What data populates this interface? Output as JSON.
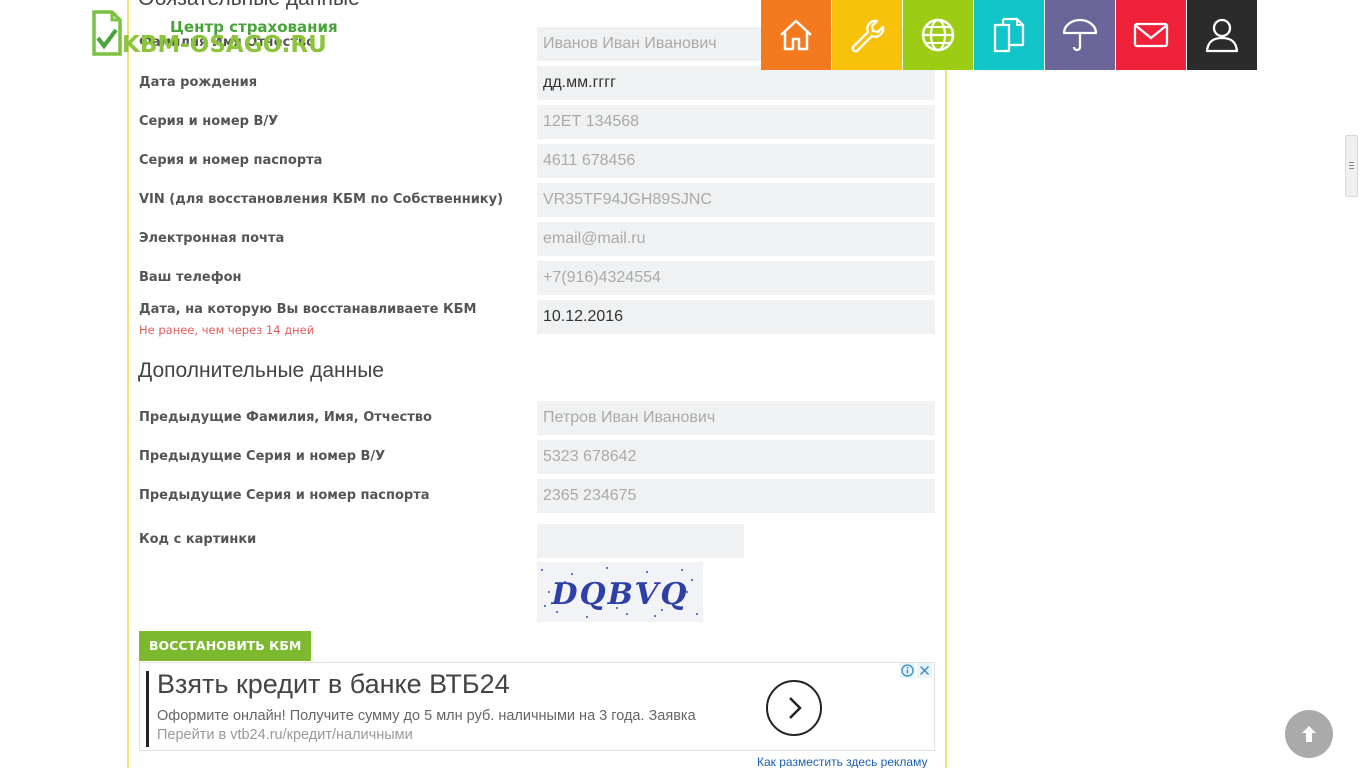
{
  "header": {
    "logo_top": "Центр страхования",
    "logo_bottom": "KBM-OSAGO.RU",
    "nav": [
      {
        "name": "home",
        "color": "#f47a20",
        "icon": "home-icon"
      },
      {
        "name": "tools",
        "color": "#f9c20a",
        "icon": "wrench-icon"
      },
      {
        "name": "web",
        "color": "#9dcc15",
        "icon": "globe-icon"
      },
      {
        "name": "documents",
        "color": "#11c4c8",
        "icon": "documents-icon"
      },
      {
        "name": "insurance",
        "color": "#6a6699",
        "icon": "umbrella-icon"
      },
      {
        "name": "mail",
        "color": "#f0223a",
        "icon": "mail-icon"
      },
      {
        "name": "account",
        "color": "#2b2b2b",
        "icon": "user-icon"
      }
    ]
  },
  "form": {
    "required_title": "Обязательные данные",
    "fields": [
      {
        "label": "Фамилия Имя Отчество",
        "placeholder": "Иванов Иван Иванович",
        "value": ""
      },
      {
        "label": "Дата рождения",
        "placeholder": "дд.мм.гггг",
        "value": "дд.мм.гггг"
      },
      {
        "label": "Серия и номер В/У",
        "placeholder": "12ЕТ 134568",
        "value": ""
      },
      {
        "label": "Серия и номер паспорта",
        "placeholder": "4611 678456",
        "value": ""
      },
      {
        "label": "VIN (для восстановления КБМ по Собственнику)",
        "placeholder": "VR35TF94JGH89SJNC",
        "value": ""
      },
      {
        "label": "Электронная почта",
        "placeholder": "email@mail.ru",
        "value": ""
      },
      {
        "label": "Ваш телефон",
        "placeholder": "+7(916)4324554",
        "value": ""
      },
      {
        "label": "Дата, на которую Вы восстанавливаете КБМ",
        "note": "Не ранее, чем через 14 дней",
        "placeholder": "",
        "value": "10.12.2016"
      }
    ],
    "additional_title": "Дополнительные данные",
    "additional_fields": [
      {
        "label": "Предыдущие Фамилия, Имя, Отчество",
        "placeholder": "Петров Иван Иванович",
        "value": ""
      },
      {
        "label": "Предыдущие Серия и номер В/У",
        "placeholder": "5323 678642",
        "value": ""
      },
      {
        "label": "Предыдущие Серия и номер паспорта",
        "placeholder": "2365 234675",
        "value": ""
      }
    ],
    "captcha_label": "Код с картинки",
    "captcha_text": "DQBVQ",
    "submit_label": "ВОССТАНОВИТЬ КБМ"
  },
  "ad": {
    "title": "Взять кредит в банке ВТБ24",
    "text": "Оформите онлайн! Получите сумму до 5 млн руб. наличными на 3 года. Заявка",
    "link": "Перейти в vtb24.ru/кредит/наличными",
    "place_link": "Как разместить здесь рекламу"
  }
}
